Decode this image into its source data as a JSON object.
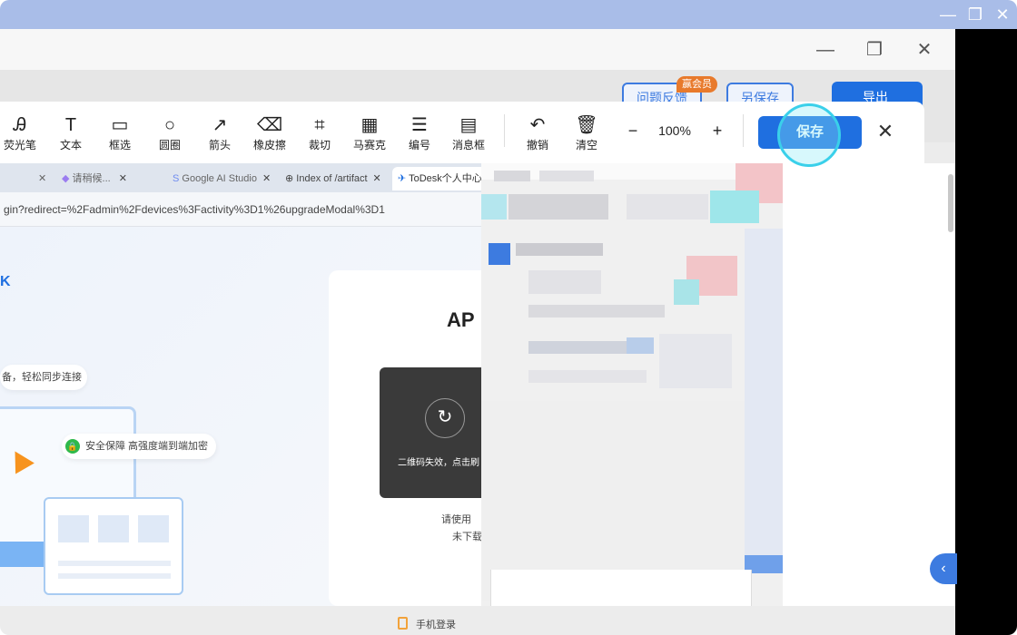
{
  "outer_window": {
    "min_icon": "minimize-icon",
    "max_icon": "restore-icon",
    "close_icon": "close-icon"
  },
  "inner_window": {
    "min_icon": "minimize-icon",
    "max_icon": "restore-icon",
    "close_icon": "close-icon"
  },
  "background_buttons": {
    "feedback": "问题反馈",
    "vip_badge": "赢会员",
    "save_as": "另保存",
    "export": "导出"
  },
  "toolbar": {
    "tools": [
      {
        "name": "highlighter",
        "label": "荧光笔",
        "icon": "Ꭿ"
      },
      {
        "name": "text",
        "label": "文本",
        "icon": "T"
      },
      {
        "name": "rect",
        "label": "框选",
        "icon": "▭"
      },
      {
        "name": "circle",
        "label": "圆圈",
        "icon": "○"
      },
      {
        "name": "arrow",
        "label": "箭头",
        "icon": "↗"
      },
      {
        "name": "eraser",
        "label": "橡皮擦",
        "icon": "⌫"
      },
      {
        "name": "crop",
        "label": "裁切",
        "icon": "⌗"
      },
      {
        "name": "mosaic",
        "label": "马赛克",
        "icon": "▦"
      },
      {
        "name": "numbering",
        "label": "编号",
        "icon": "☰"
      },
      {
        "name": "message",
        "label": "消息框",
        "icon": "▤"
      }
    ],
    "undo": {
      "label": "撤销",
      "icon": "↶"
    },
    "clear": {
      "label": "清空",
      "icon": "🗑"
    },
    "zoom_minus": "−",
    "zoom": "100%",
    "zoom_plus": "+",
    "save": "保存",
    "close": "✕"
  },
  "browser": {
    "tabs": [
      "请稍候...",
      "Google AI Studio",
      "Index of /artifact",
      "ToDesk个人中心"
    ],
    "url": "gin?redirect=%2Fadmin%2Fdevices%3Factivity%3D1%26upgradeModal%3D1"
  },
  "page": {
    "sync_text": "备，轻松同步连接",
    "security_text": "安全保障 高强度端到端加密",
    "card_title": "AP",
    "qr_expired": "二维码失效，点击刷",
    "use_text": "请使用",
    "download_text": "未下载",
    "phone_login": "手机登录"
  },
  "colors": {
    "accent": "#1f6fe0",
    "highlight_ring": "#3ad0ea",
    "outer_bar": "#a9bde8"
  }
}
